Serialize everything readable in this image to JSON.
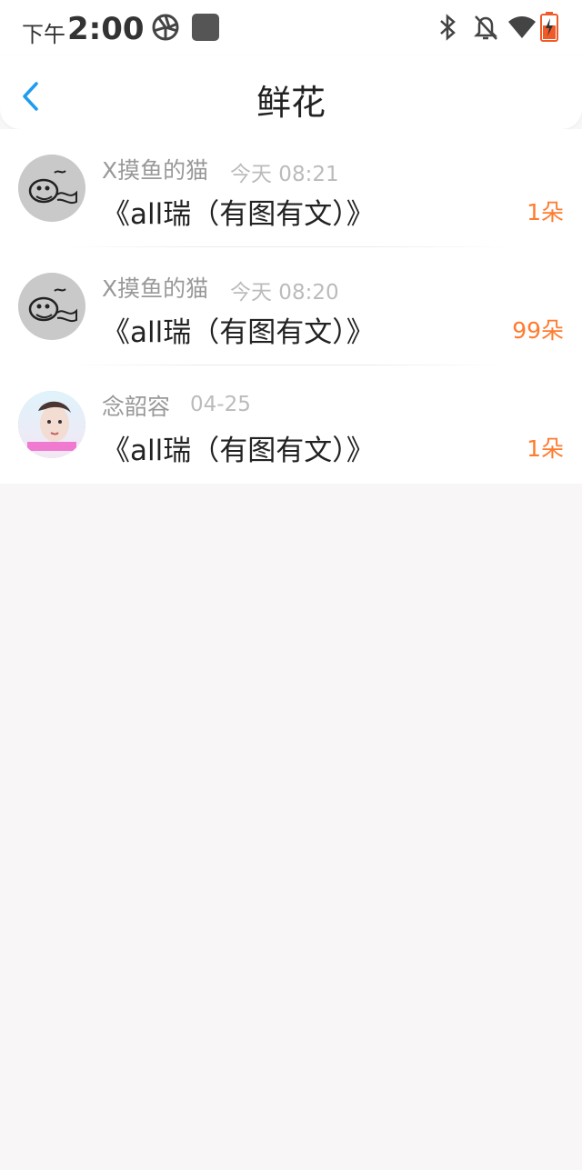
{
  "status_bar": {
    "time_prefix": "下午",
    "time": "2:00",
    "icons": [
      "app-icon-1",
      "app-icon-2",
      "bluetooth-icon",
      "notifications-off-icon",
      "wifi-icon",
      "battery-charging-icon"
    ]
  },
  "header": {
    "title": "鲜花",
    "back_icon": "chevron-left-icon"
  },
  "colors": {
    "accent": "#1f9cf0",
    "flower_count": "#ff7b2e",
    "background": "#f8f6f7"
  },
  "items": [
    {
      "user": "X摸鱼的猫",
      "time": "今天 08:21",
      "article": "《all瑞（有图有文）》",
      "flowers": "1朵"
    },
    {
      "user": "X摸鱼的猫",
      "time": "今天 08:20",
      "article": "《all瑞（有图有文）》",
      "flowers": "99朵"
    },
    {
      "user": "念韶容",
      "time": "04-25",
      "article": "《all瑞（有图有文）》",
      "flowers": "1朵"
    }
  ]
}
